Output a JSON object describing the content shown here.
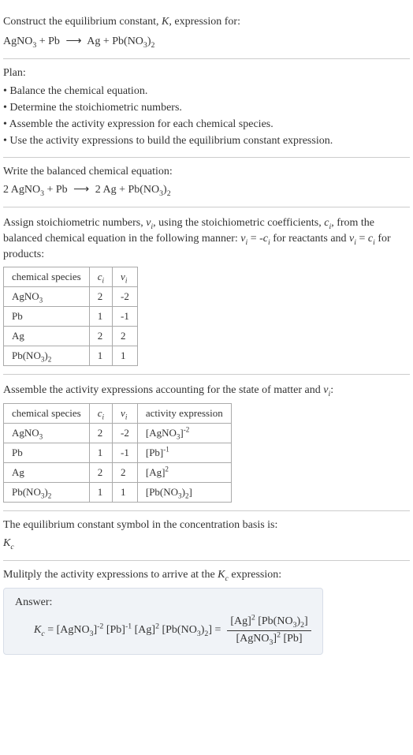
{
  "prompt": {
    "line1": "Construct the equilibrium constant, K, expression for:",
    "equation": "AgNO₃ + Pb ⟶ Ag + Pb(NO₃)₂"
  },
  "plan": {
    "title": "Plan:",
    "items": [
      "• Balance the chemical equation.",
      "• Determine the stoichiometric numbers.",
      "• Assemble the activity expression for each chemical species.",
      "• Use the activity expressions to build the equilibrium constant expression."
    ]
  },
  "balanced": {
    "title": "Write the balanced chemical equation:",
    "equation": "2 AgNO₃ + Pb ⟶ 2 Ag + Pb(NO₃)₂"
  },
  "stoich": {
    "text": "Assign stoichiometric numbers, νᵢ, using the stoichiometric coefficients, cᵢ, from the balanced chemical equation in the following manner: νᵢ = -cᵢ for reactants and νᵢ = cᵢ for products:",
    "headers": {
      "species": "chemical species",
      "ci": "cᵢ",
      "vi": "νᵢ"
    },
    "rows": [
      {
        "species": "AgNO₃",
        "ci": "2",
        "vi": "-2"
      },
      {
        "species": "Pb",
        "ci": "1",
        "vi": "-1"
      },
      {
        "species": "Ag",
        "ci": "2",
        "vi": "2"
      },
      {
        "species": "Pb(NO₃)₂",
        "ci": "1",
        "vi": "1"
      }
    ]
  },
  "activity": {
    "title": "Assemble the activity expressions accounting for the state of matter and νᵢ:",
    "headers": {
      "species": "chemical species",
      "ci": "cᵢ",
      "vi": "νᵢ",
      "expr": "activity expression"
    },
    "rows": [
      {
        "species": "AgNO₃",
        "ci": "2",
        "vi": "-2",
        "expr": "[AgNO₃]⁻²"
      },
      {
        "species": "Pb",
        "ci": "1",
        "vi": "-1",
        "expr": "[Pb]⁻¹"
      },
      {
        "species": "Ag",
        "ci": "2",
        "vi": "2",
        "expr": "[Ag]²"
      },
      {
        "species": "Pb(NO₃)₂",
        "ci": "1",
        "vi": "1",
        "expr": "[Pb(NO₃)₂]"
      }
    ]
  },
  "symbol": {
    "line1": "The equilibrium constant symbol in the concentration basis is:",
    "line2": "K_c"
  },
  "multiply": {
    "title": "Mulitply the activity expressions to arrive at the K_c expression:"
  },
  "answer": {
    "label": "Answer:",
    "lhs": "K_c = [AgNO₃]⁻² [Pb]⁻¹ [Ag]² [Pb(NO₃)₂] =",
    "numerator": "[Ag]² [Pb(NO₃)₂]",
    "denominator": "[AgNO₃]² [Pb]"
  },
  "chart_data": {
    "type": "table",
    "tables": [
      {
        "title": "stoichiometric numbers",
        "columns": [
          "chemical species",
          "c_i",
          "ν_i"
        ],
        "rows": [
          [
            "AgNO3",
            2,
            -2
          ],
          [
            "Pb",
            1,
            -1
          ],
          [
            "Ag",
            2,
            2
          ],
          [
            "Pb(NO3)2",
            1,
            1
          ]
        ]
      },
      {
        "title": "activity expressions",
        "columns": [
          "chemical species",
          "c_i",
          "ν_i",
          "activity expression"
        ],
        "rows": [
          [
            "AgNO3",
            2,
            -2,
            "[AgNO3]^-2"
          ],
          [
            "Pb",
            1,
            -1,
            "[Pb]^-1"
          ],
          [
            "Ag",
            2,
            2,
            "[Ag]^2"
          ],
          [
            "Pb(NO3)2",
            1,
            1,
            "[Pb(NO3)2]"
          ]
        ]
      }
    ]
  }
}
